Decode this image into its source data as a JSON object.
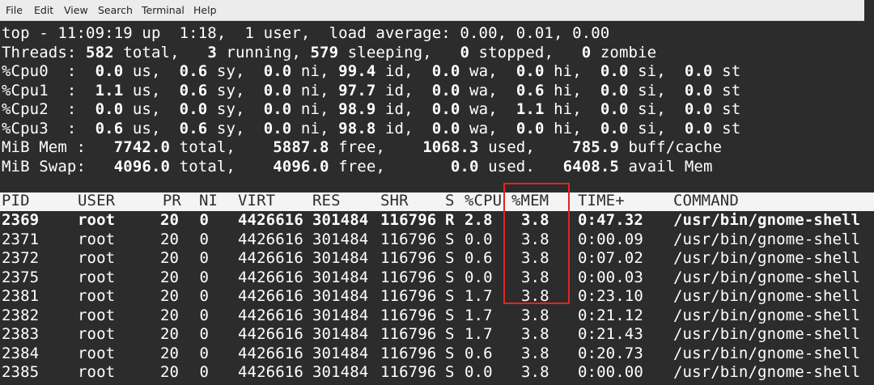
{
  "menu": [
    "File",
    "Edit",
    "View",
    "Search",
    "Terminal",
    "Help"
  ],
  "summary": [
    [
      {
        "t": "top - 11:09:19 up  1:18,  1 user,  load average: 0.00, 0.01, 0.00"
      }
    ],
    [
      {
        "t": "Threads: "
      },
      {
        "t": "582",
        "b": 1
      },
      {
        "t": " total,   "
      },
      {
        "t": "3",
        "b": 1
      },
      {
        "t": " running, "
      },
      {
        "t": "579",
        "b": 1
      },
      {
        "t": " sleeping,   "
      },
      {
        "t": "0",
        "b": 1
      },
      {
        "t": " stopped,   "
      },
      {
        "t": "0",
        "b": 1
      },
      {
        "t": " zombie"
      }
    ],
    [
      {
        "t": "%Cpu0  :  "
      },
      {
        "t": "0.0",
        "b": 1
      },
      {
        "t": " us,  "
      },
      {
        "t": "0.6",
        "b": 1
      },
      {
        "t": " sy,  "
      },
      {
        "t": "0.0",
        "b": 1
      },
      {
        "t": " ni, "
      },
      {
        "t": "99.4",
        "b": 1
      },
      {
        "t": " id,  "
      },
      {
        "t": "0.0",
        "b": 1
      },
      {
        "t": " wa,  "
      },
      {
        "t": "0.0",
        "b": 1
      },
      {
        "t": " hi,  "
      },
      {
        "t": "0.0",
        "b": 1
      },
      {
        "t": " si,  "
      },
      {
        "t": "0.0",
        "b": 1
      },
      {
        "t": " st"
      }
    ],
    [
      {
        "t": "%Cpu1  :  "
      },
      {
        "t": "1.1",
        "b": 1
      },
      {
        "t": " us,  "
      },
      {
        "t": "0.6",
        "b": 1
      },
      {
        "t": " sy,  "
      },
      {
        "t": "0.0",
        "b": 1
      },
      {
        "t": " ni, "
      },
      {
        "t": "97.7",
        "b": 1
      },
      {
        "t": " id,  "
      },
      {
        "t": "0.0",
        "b": 1
      },
      {
        "t": " wa,  "
      },
      {
        "t": "0.6",
        "b": 1
      },
      {
        "t": " hi,  "
      },
      {
        "t": "0.0",
        "b": 1
      },
      {
        "t": " si,  "
      },
      {
        "t": "0.0",
        "b": 1
      },
      {
        "t": " st"
      }
    ],
    [
      {
        "t": "%Cpu2  :  "
      },
      {
        "t": "0.0",
        "b": 1
      },
      {
        "t": " us,  "
      },
      {
        "t": "0.0",
        "b": 1
      },
      {
        "t": " sy,  "
      },
      {
        "t": "0.0",
        "b": 1
      },
      {
        "t": " ni, "
      },
      {
        "t": "98.9",
        "b": 1
      },
      {
        "t": " id,  "
      },
      {
        "t": "0.0",
        "b": 1
      },
      {
        "t": " wa,  "
      },
      {
        "t": "1.1",
        "b": 1
      },
      {
        "t": " hi,  "
      },
      {
        "t": "0.0",
        "b": 1
      },
      {
        "t": " si,  "
      },
      {
        "t": "0.0",
        "b": 1
      },
      {
        "t": " st"
      }
    ],
    [
      {
        "t": "%Cpu3  :  "
      },
      {
        "t": "0.6",
        "b": 1
      },
      {
        "t": " us,  "
      },
      {
        "t": "0.6",
        "b": 1
      },
      {
        "t": " sy,  "
      },
      {
        "t": "0.0",
        "b": 1
      },
      {
        "t": " ni, "
      },
      {
        "t": "98.8",
        "b": 1
      },
      {
        "t": " id,  "
      },
      {
        "t": "0.0",
        "b": 1
      },
      {
        "t": " wa,  "
      },
      {
        "t": "0.0",
        "b": 1
      },
      {
        "t": " hi,  "
      },
      {
        "t": "0.0",
        "b": 1
      },
      {
        "t": " si,  "
      },
      {
        "t": "0.0",
        "b": 1
      },
      {
        "t": " st"
      }
    ],
    [
      {
        "t": "MiB Mem :   "
      },
      {
        "t": "7742.0",
        "b": 1
      },
      {
        "t": " total,    "
      },
      {
        "t": "5887.8",
        "b": 1
      },
      {
        "t": " free,    "
      },
      {
        "t": "1068.3",
        "b": 1
      },
      {
        "t": " used,    "
      },
      {
        "t": "785.9",
        "b": 1
      },
      {
        "t": " buff/cache"
      }
    ],
    [
      {
        "t": "MiB Swap:   "
      },
      {
        "t": "4096.0",
        "b": 1
      },
      {
        "t": " total,    "
      },
      {
        "t": "4096.0",
        "b": 1
      },
      {
        "t": " free,       "
      },
      {
        "t": "0.0",
        "b": 1
      },
      {
        "t": " used.   "
      },
      {
        "t": "6408.5",
        "b": 1
      },
      {
        "t": " avail Mem"
      }
    ]
  ],
  "columns": [
    "PID",
    "USER",
    "PR",
    "NI",
    "VIRT",
    "RES",
    "SHR",
    "S",
    "%CPU",
    "%MEM",
    "TIME+",
    "COMMAND"
  ],
  "processes": [
    {
      "pid": "2369",
      "user": "root",
      "pr": "20",
      "ni": "0",
      "virt": "4426616",
      "res": "301484",
      "shr": "116796",
      "s": "R",
      "cpu": "2.8",
      "mem": "3.8",
      "time": "0:47.32",
      "cmd": "/usr/bin/gnome-shell",
      "bold": true
    },
    {
      "pid": "2371",
      "user": "root",
      "pr": "20",
      "ni": "0",
      "virt": "4426616",
      "res": "301484",
      "shr": "116796",
      "s": "S",
      "cpu": "0.0",
      "mem": "3.8",
      "time": "0:00.09",
      "cmd": "/usr/bin/gnome-shell"
    },
    {
      "pid": "2372",
      "user": "root",
      "pr": "20",
      "ni": "0",
      "virt": "4426616",
      "res": "301484",
      "shr": "116796",
      "s": "S",
      "cpu": "0.6",
      "mem": "3.8",
      "time": "0:07.02",
      "cmd": "/usr/bin/gnome-shell"
    },
    {
      "pid": "2375",
      "user": "root",
      "pr": "20",
      "ni": "0",
      "virt": "4426616",
      "res": "301484",
      "shr": "116796",
      "s": "S",
      "cpu": "0.0",
      "mem": "3.8",
      "time": "0:00.03",
      "cmd": "/usr/bin/gnome-shell"
    },
    {
      "pid": "2381",
      "user": "root",
      "pr": "20",
      "ni": "0",
      "virt": "4426616",
      "res": "301484",
      "shr": "116796",
      "s": "S",
      "cpu": "1.7",
      "mem": "3.8",
      "time": "0:23.10",
      "cmd": "/usr/bin/gnome-shell"
    },
    {
      "pid": "2382",
      "user": "root",
      "pr": "20",
      "ni": "0",
      "virt": "4426616",
      "res": "301484",
      "shr": "116796",
      "s": "S",
      "cpu": "1.7",
      "mem": "3.8",
      "time": "0:21.12",
      "cmd": "/usr/bin/gnome-shell"
    },
    {
      "pid": "2383",
      "user": "root",
      "pr": "20",
      "ni": "0",
      "virt": "4426616",
      "res": "301484",
      "shr": "116796",
      "s": "S",
      "cpu": "1.7",
      "mem": "3.8",
      "time": "0:21.43",
      "cmd": "/usr/bin/gnome-shell"
    },
    {
      "pid": "2384",
      "user": "root",
      "pr": "20",
      "ni": "0",
      "virt": "4426616",
      "res": "301484",
      "shr": "116796",
      "s": "S",
      "cpu": "0.6",
      "mem": "3.8",
      "time": "0:20.73",
      "cmd": "/usr/bin/gnome-shell"
    },
    {
      "pid": "2385",
      "user": "root",
      "pr": "20",
      "ni": "0",
      "virt": "4426616",
      "res": "301484",
      "shr": "116796",
      "s": "S",
      "cpu": "0.0",
      "mem": "3.8",
      "time": "0:00.00",
      "cmd": "/usr/bin/gnome-shell"
    }
  ],
  "colors": {
    "background": "#2c2c2c",
    "text": "#ffffff",
    "header_bg": "#f4f4f4",
    "highlight_box": "#e02424"
  }
}
